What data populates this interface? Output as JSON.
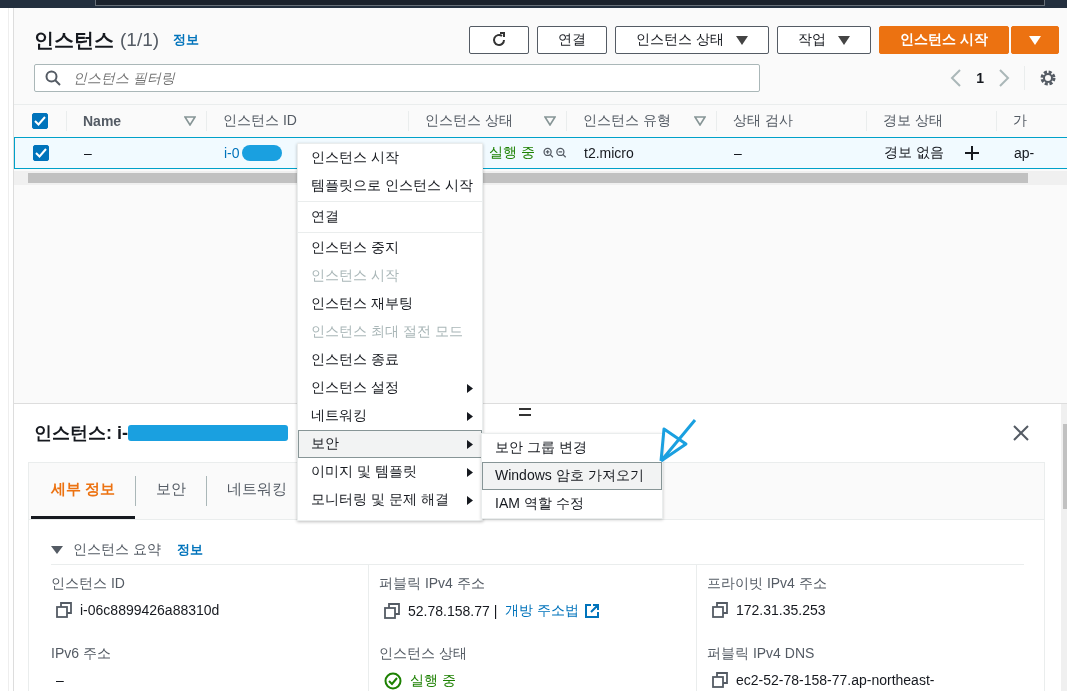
{
  "header": {
    "title": "인스턴스",
    "count": "(1/1)",
    "info": "정보",
    "buttons": [
      {
        "kind": "refresh"
      },
      {
        "kind": "plain",
        "label": "연결"
      },
      {
        "kind": "dropdown",
        "label": "인스턴스 상태"
      },
      {
        "kind": "dropdown",
        "label": "작업"
      },
      {
        "kind": "primary",
        "label": "인스턴스 시작"
      },
      {
        "kind": "primary-caret"
      }
    ]
  },
  "filter": {
    "placeholder": "인스턴스 필터링"
  },
  "pagination": {
    "page": "1"
  },
  "table": {
    "all_checked": true,
    "columns": [
      {
        "label": "Name",
        "filter": true
      },
      {
        "label": "인스턴스 ID",
        "filter": false
      },
      {
        "label": "인스턴스 상태",
        "filter": true
      },
      {
        "label": "인스턴스 유형",
        "filter": true
      },
      {
        "label": "상태 검사",
        "filter": false
      },
      {
        "label": "경보 상태",
        "filter": false
      },
      {
        "label": "가",
        "filter": false
      }
    ],
    "rows": [
      {
        "checked": true,
        "selected": true,
        "name": "–",
        "id": "i-0",
        "state": "실행 중",
        "type": "t2.micro",
        "check": "–",
        "alarm": "경보 없음",
        "zone": "ap-"
      }
    ]
  },
  "context_menu": {
    "groups": [
      [
        {
          "label": "인스턴스 시작",
          "disabled": false,
          "submenu": false,
          "selected": false
        },
        {
          "label": "템플릿으로 인스턴스 시작",
          "disabled": false,
          "submenu": false,
          "selected": false
        }
      ],
      [
        {
          "label": "연결",
          "disabled": false,
          "submenu": false,
          "selected": false
        }
      ],
      [
        {
          "label": "인스턴스 중지",
          "disabled": false,
          "submenu": false,
          "selected": false
        },
        {
          "label": "인스턴스 시작",
          "disabled": true,
          "submenu": false,
          "selected": false
        },
        {
          "label": "인스턴스 재부팅",
          "disabled": false,
          "submenu": false,
          "selected": false
        },
        {
          "label": "인스턴스 최대 절전 모드",
          "disabled": true,
          "submenu": false,
          "selected": false
        },
        {
          "label": "인스턴스 종료",
          "disabled": false,
          "submenu": false,
          "selected": false
        },
        {
          "label": "인스턴스 설정",
          "disabled": false,
          "submenu": true,
          "selected": false
        },
        {
          "label": "네트워킹",
          "disabled": false,
          "submenu": true,
          "selected": false
        },
        {
          "label": "보안",
          "disabled": false,
          "submenu": true,
          "selected": true
        },
        {
          "label": "이미지 및 템플릿",
          "disabled": false,
          "submenu": true,
          "selected": false
        },
        {
          "label": "모니터링 및 문제 해결",
          "disabled": false,
          "submenu": true,
          "selected": false
        }
      ]
    ],
    "submenu": [
      {
        "label": "보안 그룹 변경",
        "selected": false
      },
      {
        "label": "Windows 암호 가져오기",
        "selected": true
      },
      {
        "label": "IAM 역할 수정",
        "selected": false
      }
    ]
  },
  "details": {
    "title": "인스턴스: i-",
    "tabs": [
      {
        "label": "세부 정보",
        "selected": true
      },
      {
        "label": "보안",
        "selected": false
      },
      {
        "label": "네트워킹",
        "selected": false
      }
    ],
    "section": {
      "title": "인스턴스 요약",
      "info": "정보",
      "expanded": true
    },
    "columns": [
      [
        {
          "label": "인스턴스 ID",
          "kind": "copy",
          "value": "i-06c8899426a88310d"
        },
        {
          "label": "IPv6 주소",
          "kind": "plain",
          "value": "–"
        }
      ],
      [
        {
          "label": "퍼블릭 IPv4 주소",
          "kind": "copy",
          "value": "52.78.158.77 |",
          "link": "개방 주소법"
        },
        {
          "label": "인스턴스 상태",
          "kind": "status",
          "value": "실행 중"
        }
      ],
      [
        {
          "label": "프라이빗 IPv4 주소",
          "kind": "copy",
          "value": "172.31.35.253"
        },
        {
          "label": "퍼블릭 IPv4 DNS",
          "kind": "copy",
          "value": "ec2-52-78-158-77.ap-northeast-"
        }
      ]
    ]
  }
}
